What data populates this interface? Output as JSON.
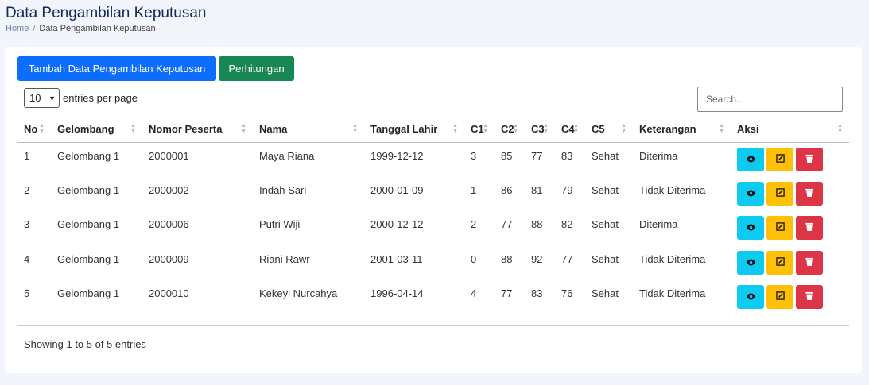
{
  "header": {
    "title": "Data Pengambilan Keputusan",
    "breadcrumb": {
      "home": "Home",
      "separator": "/",
      "current": "Data Pengambilan Keputusan"
    }
  },
  "toolbar": {
    "add_label": "Tambah Data Pengambilan Keputusan",
    "calc_label": "Perhitungan"
  },
  "entries": {
    "value": "10",
    "label": "entries per page"
  },
  "search": {
    "placeholder": "Search..."
  },
  "table": {
    "columns": [
      "No",
      "Gelombang",
      "Nomor Peserta",
      "Nama",
      "Tanggal Lahir",
      "C1",
      "C2",
      "C3",
      "C4",
      "C5",
      "Keterangan",
      "Aksi"
    ],
    "rows": [
      [
        "1",
        "Gelombang 1",
        "2000001",
        "Maya Riana",
        "1999-12-12",
        "3",
        "85",
        "77",
        "83",
        "Sehat",
        "Diterima"
      ],
      [
        "2",
        "Gelombang 1",
        "2000002",
        "Indah Sari",
        "2000-01-09",
        "1",
        "86",
        "81",
        "79",
        "Sehat",
        "Tidak Diterima"
      ],
      [
        "3",
        "Gelombang 1",
        "2000006",
        "Putri Wiji",
        "2000-12-12",
        "2",
        "77",
        "88",
        "82",
        "Sehat",
        "Diterima"
      ],
      [
        "4",
        "Gelombang 1",
        "2000009",
        "Riani Rawr",
        "2001-03-11",
        "0",
        "88",
        "92",
        "77",
        "Sehat",
        "Tidak Diterima"
      ],
      [
        "5",
        "Gelombang 1",
        "2000010",
        "Kekeyi Nurcahya",
        "1996-04-14",
        "4",
        "77",
        "83",
        "76",
        "Sehat",
        "Tidak Diterima"
      ]
    ],
    "action_icons": [
      "eye-icon",
      "edit-icon",
      "trash-icon"
    ]
  },
  "footer": {
    "showing": "Showing 1 to 5 of 5 entries"
  },
  "colors": {
    "primary": "#0d6efd",
    "success": "#198754",
    "info": "#0dcaf0",
    "warning": "#ffc107",
    "danger": "#dc3545"
  }
}
